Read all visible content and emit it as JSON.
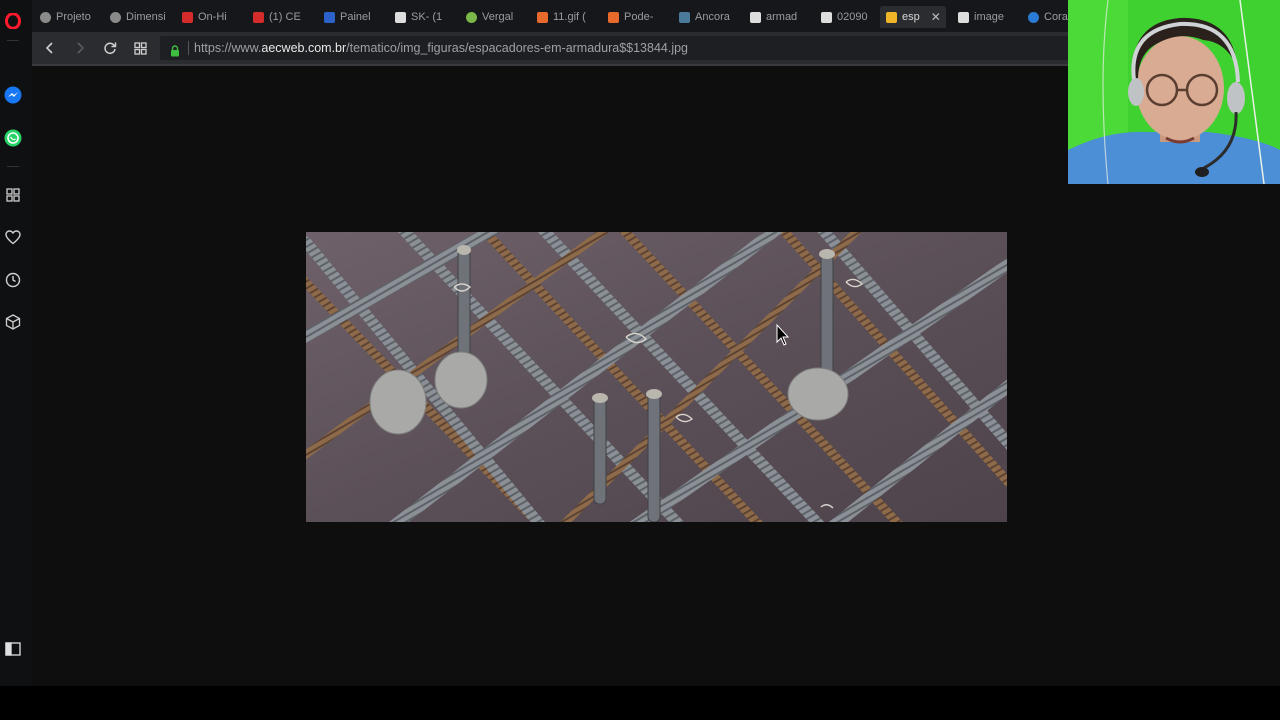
{
  "browser": {
    "name": "Opera",
    "tabs": [
      {
        "label": "Projeto",
        "favicon_color": "#8a8a8a"
      },
      {
        "label": "Dimensi",
        "favicon_color": "#8a8a8a"
      },
      {
        "label": "On-Hi",
        "favicon_color": "#d62b2b"
      },
      {
        "label": "(1) CE",
        "favicon_color": "#d62b2b"
      },
      {
        "label": "Painel",
        "favicon_color": "#2a62c9"
      },
      {
        "label": "SK- (1",
        "favicon_color": "#dddddd"
      },
      {
        "label": "Vergal",
        "favicon_color": "#7ab648"
      },
      {
        "label": "11.gif (",
        "favicon_color": "#e8692c"
      },
      {
        "label": "Pode-",
        "favicon_color": "#e8692c"
      },
      {
        "label": "Ancora",
        "favicon_color": "#4a7a9a"
      },
      {
        "label": "armad",
        "favicon_color": "#dddddd"
      },
      {
        "label": "02090",
        "favicon_color": "#dddddd"
      },
      {
        "label": "esp",
        "favicon_color": "#f0b429",
        "active": true
      },
      {
        "label": "image",
        "favicon_color": "#dddddd"
      },
      {
        "label": "Cora",
        "favicon_color": "#2a7ad6"
      }
    ],
    "close_glyph": "✕",
    "back_icon": "‹",
    "forward_icon": "›",
    "reload_icon": "↻",
    "tabs_grid_icon": "▦",
    "url_prefix": "https://www.",
    "url_domain": "aecweb.com.br",
    "url_path": "/tematico/img_figuras/espacadores-em-armadura$$13844.jpg",
    "accent": "#ff1b2d"
  },
  "sidebar": {
    "items": [
      {
        "name": "opera-logo-icon"
      },
      {
        "name": "messenger-icon",
        "color": "#1877f2"
      },
      {
        "name": "whatsapp-icon",
        "color": "#25d366"
      },
      {
        "name": "speed-dial-icon"
      },
      {
        "name": "heart-icon"
      },
      {
        "name": "history-icon"
      },
      {
        "name": "extensions-icon"
      },
      {
        "name": "sidebar-toggle-icon"
      }
    ]
  },
  "content": {
    "image_subject": "rebar-spacers-photo"
  },
  "overlay": {
    "webcam_background": "#3fd12f"
  }
}
